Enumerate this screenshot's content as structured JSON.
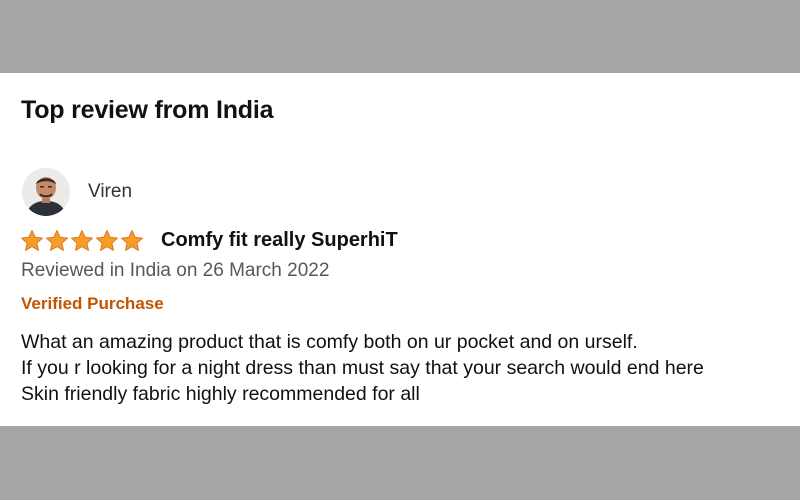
{
  "section_title": "Top review from India",
  "review": {
    "reviewer_name": "Viren",
    "avatar_icon": "user-avatar",
    "rating": 5,
    "rating_max": 5,
    "star_icon": "star-icon",
    "star_color": "#f69c29",
    "title": "Comfy fit really SuperhiT",
    "date_text": "Reviewed in India on 26 March 2022",
    "verified_text": "Verified Purchase",
    "verified_color": "#c45500",
    "body_lines": [
      "What an amazing product that is comfy both on ur pocket and on urself.",
      "If you r looking for a night dress than must say that your search would end here",
      "Skin friendly fabric highly recommended for all"
    ]
  },
  "colors": {
    "backdrop": "#a6a6a6",
    "card": "#ffffff",
    "text_primary": "#111111",
    "text_secondary": "#565959"
  }
}
